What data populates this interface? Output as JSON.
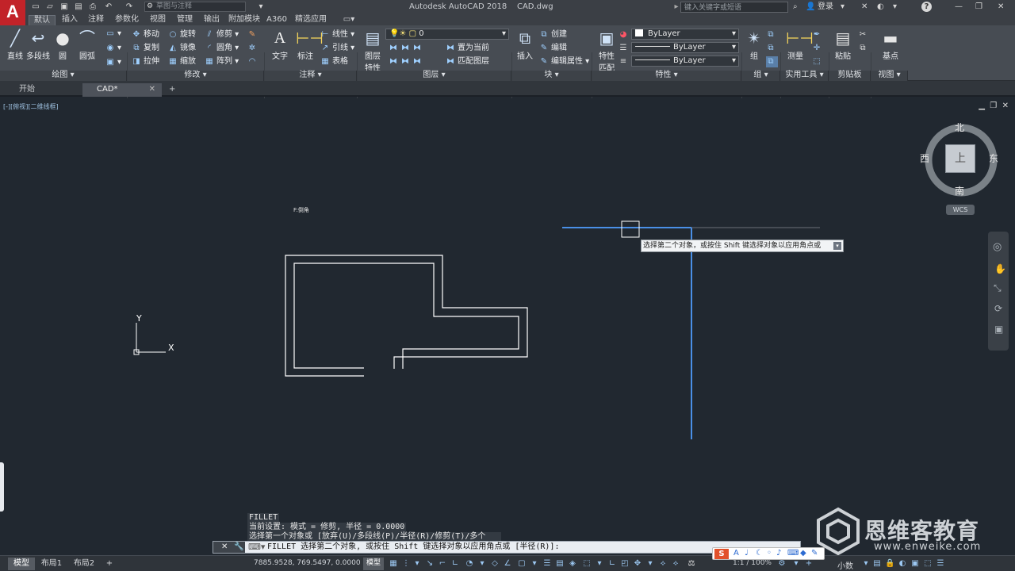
{
  "app": {
    "title": "Autodesk AutoCAD 2018    CAD.dwg",
    "logo": "A"
  },
  "quick_access": {
    "workspace": "草图与注释",
    "icons": [
      "new-icon",
      "open-icon",
      "save-icon",
      "saveas-icon",
      "print-icon",
      "undo-icon",
      "redo-icon"
    ]
  },
  "search": {
    "placeholder": "键入关键字或短语",
    "login": "登录"
  },
  "ribbon_tabs": [
    "默认",
    "插入",
    "注释",
    "参数化",
    "视图",
    "管理",
    "输出",
    "附加模块",
    "A360",
    "精选应用"
  ],
  "ribbon": {
    "draw": {
      "title": "绘图 ▾",
      "line": "直线",
      "polyline": "多段线",
      "circle": "圆",
      "arc": "圆弧"
    },
    "modify": {
      "title": "修改 ▾",
      "move": "移动",
      "rotate": "旋转",
      "trim": "修剪",
      "copy": "复制",
      "mirror": "镜像",
      "fillet": "圆角",
      "stretch": "拉伸",
      "scale": "缩放",
      "array": "阵列"
    },
    "annotation": {
      "title": "注释 ▾",
      "text": "文字",
      "dimension": "标注",
      "linear": "线性",
      "leader": "引线",
      "table": "表格"
    },
    "layers": {
      "title": "图层 ▾",
      "props1": "图层",
      "props2": "特性",
      "layer_value": "0",
      "make_current": "置为当前",
      "match_layer": "匹配图层"
    },
    "block": {
      "title": "块 ▾",
      "insert": "插入",
      "create": "创建",
      "edit": "编辑",
      "edit_attr": "编辑属性 ▾"
    },
    "properties": {
      "title": "特性 ▾",
      "match1": "特性",
      "match2": "匹配",
      "color": "ByLayer",
      "linetype": "ByLayer",
      "lineweight": "ByLayer"
    },
    "groups": {
      "title": "组 ▾",
      "group": "组"
    },
    "utilities": {
      "title": "实用工具 ▾",
      "measure": "测量"
    },
    "clipboard": {
      "title": "剪贴板",
      "paste": "粘贴"
    },
    "view": {
      "title": "视图 ▾",
      "base": "基点"
    }
  },
  "doc_tabs": [
    "开始",
    "CAD*"
  ],
  "viewport": {
    "label": "[-][俯视][二维线框]"
  },
  "viewcube": {
    "north": "北",
    "south": "南",
    "east": "东",
    "west": "西",
    "face": "上",
    "wcs": "WCS"
  },
  "canvas": {
    "axis_x": "X",
    "axis_y": "Y",
    "cursor_label": "F:倒角"
  },
  "tooltip": "选择第二个对象，或按住 Shift 键选择对象以应用角点或",
  "command": {
    "history": [
      "FILLET",
      "当前设置: 模式 = 修剪, 半径 = 0.0000",
      "选择第一个对象或 [放弃(U)/多段线(P)/半径(R)/修剪(T)/多个(M)]:"
    ],
    "prompt": "FILLET 选择第二个对象, 或按住 Shift 键选择对象以应用角点或 [半径(R)]:"
  },
  "status": {
    "layouts": [
      "模型",
      "布局1",
      "布局2"
    ],
    "coords": "7885.9528, 769.5497, 0.0000",
    "model": "模型",
    "scale": "1:1 / 100%",
    "units": "小数"
  },
  "watermark": {
    "name": "恩维客教育",
    "url": "www.enweike.com"
  },
  "colors": {
    "background": "#212830",
    "selection": "#3a8ff0",
    "ribbon": "#474c53",
    "logo": "#c22329"
  }
}
